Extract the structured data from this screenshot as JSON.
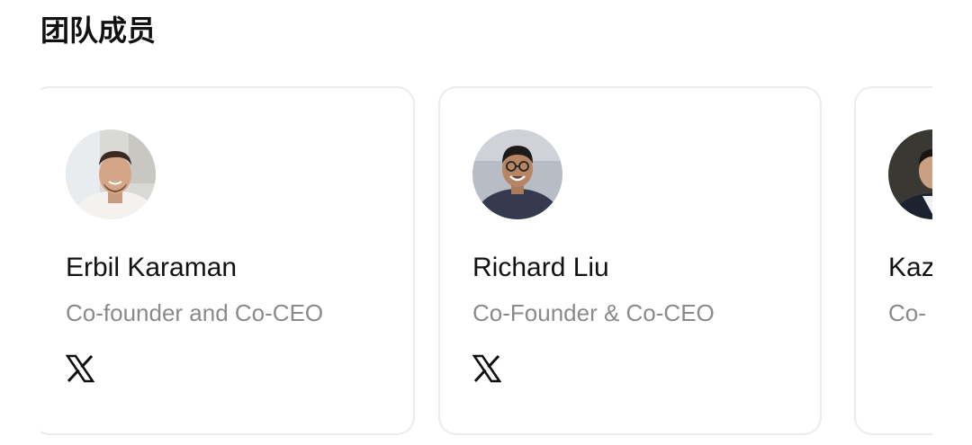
{
  "section": {
    "title": "团队成员"
  },
  "members": [
    {
      "name": "Erbil Karaman",
      "role": "Co-founder and Co-CEO",
      "social_icon": "x-logo-icon"
    },
    {
      "name": "Richard Liu",
      "role": "Co-Founder & Co-CEO",
      "social_icon": "x-logo-icon"
    },
    {
      "name": "Kaz",
      "role": "Co-",
      "social_icon": "x-logo-icon"
    }
  ],
  "colors": {
    "card_border": "#ececec",
    "name_text": "#111111",
    "role_text": "#8a8a8a"
  }
}
